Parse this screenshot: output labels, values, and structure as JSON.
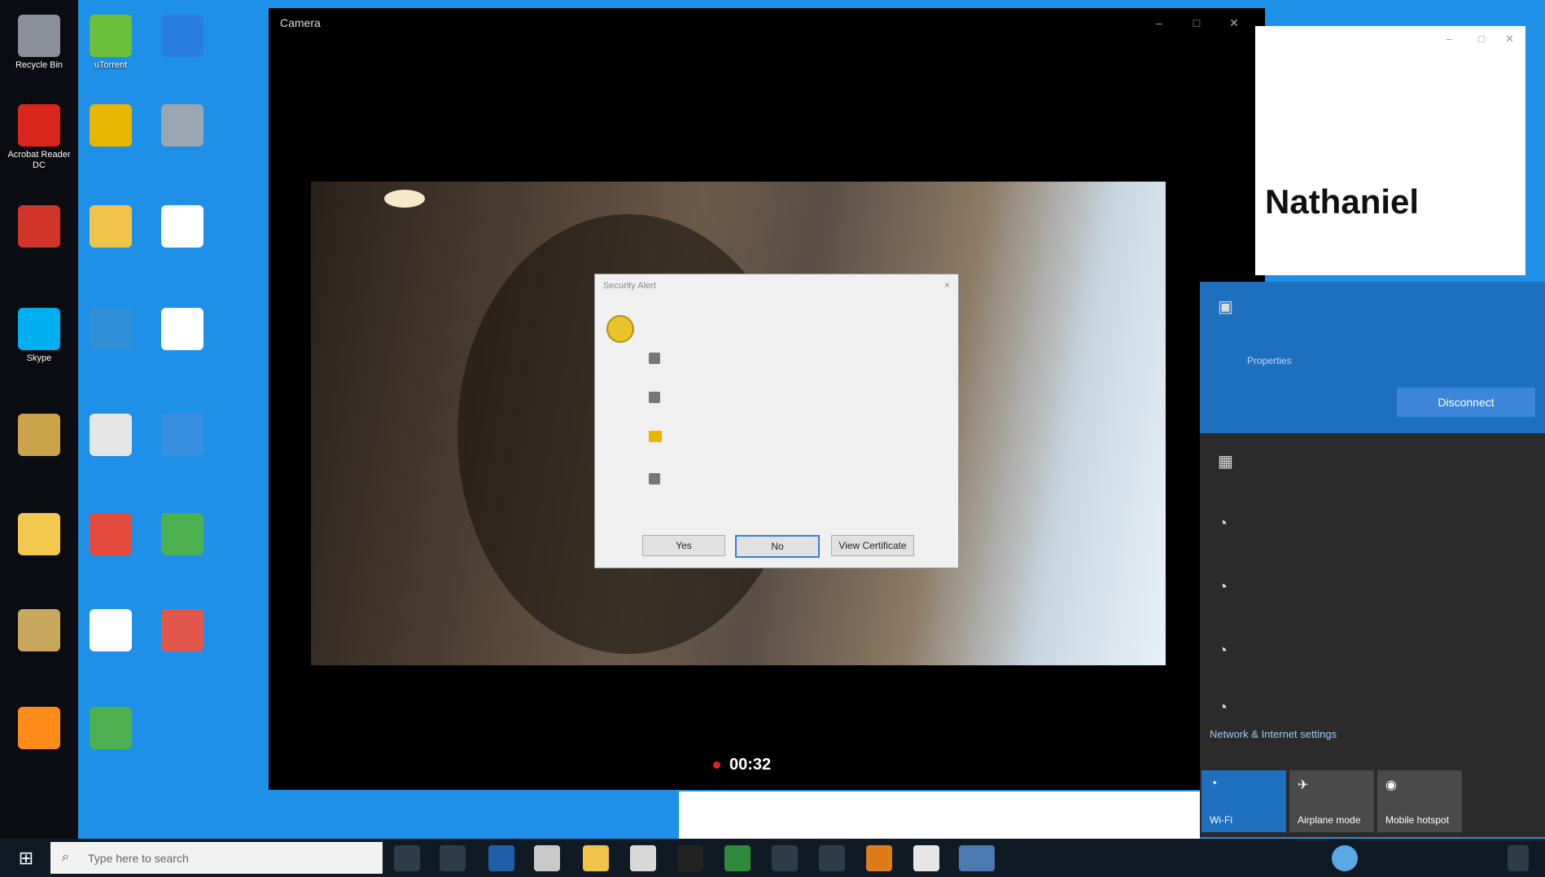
{
  "desktop": {
    "icons": [
      {
        "label": "Recycle Bin",
        "color": "#8a8f98"
      },
      {
        "label": "uTorrent",
        "color": "#6cbf3a"
      },
      {
        "label": "",
        "color": "#2a7ee0"
      },
      {
        "label": "Acrobat Reader DC",
        "color": "#d9261c"
      },
      {
        "label": "",
        "color": "#e8b500"
      },
      {
        "label": "",
        "color": "#9aa6b2"
      },
      {
        "label": "",
        "color": "#d1352a"
      },
      {
        "label": "",
        "color": "#f2c34a"
      },
      {
        "label": "",
        "color": "#ffffff"
      },
      {
        "label": "Skype",
        "color": "#00aff0"
      },
      {
        "label": "",
        "color": "#2f8fd6"
      },
      {
        "label": "",
        "color": "#ffffff"
      },
      {
        "label": "",
        "color": "#caa24a"
      },
      {
        "label": "",
        "color": "#e6e6e6"
      },
      {
        "label": "",
        "color": "#3a8ee0"
      },
      {
        "label": "",
        "color": "#f2c94c"
      },
      {
        "label": "",
        "color": "#e24a3b"
      },
      {
        "label": "",
        "color": "#4caf50"
      },
      {
        "label": "",
        "color": "#c8a85c"
      },
      {
        "label": "",
        "color": "#ffffff"
      },
      {
        "label": "",
        "color": "#ff8c1a"
      },
      {
        "label": "",
        "color": "#4caf50"
      },
      {
        "label": "",
        "color": "#e2574c"
      },
      {
        "label": "",
        "color": "#111111"
      }
    ]
  },
  "camera": {
    "title": "Camera",
    "timer": "00:32"
  },
  "dialog": {
    "title": "Security Alert",
    "close": "×",
    "main_text": "",
    "rows": [
      {
        "text": "",
        "icon": "info"
      },
      {
        "text": "",
        "icon": "info"
      },
      {
        "text": "",
        "icon": "warning"
      },
      {
        "text": "",
        "icon": "info"
      }
    ],
    "question": "",
    "buttons": [
      "Yes",
      "No",
      "View Certificate"
    ]
  },
  "note": {
    "name": "Nathaniel"
  },
  "network": {
    "connected": {
      "name": "",
      "status": "",
      "properties": "Properties",
      "disconnect": "Disconnect"
    },
    "items": [
      {
        "name": "",
        "status": ""
      },
      {
        "name": "",
        "status": ""
      },
      {
        "name": "",
        "status": ""
      },
      {
        "name": "",
        "status": ""
      },
      {
        "name": "",
        "status": ""
      }
    ],
    "settings_title": "Network & Internet settings",
    "settings_sub": "",
    "tiles": [
      {
        "label": "Wi-Fi",
        "icon": "wifi-icon"
      },
      {
        "label": "Airplane mode",
        "icon": "airplane-icon"
      },
      {
        "label": "Mobile hotspot",
        "icon": "hotspot-icon"
      }
    ]
  },
  "taskbar": {
    "search_placeholder": "Type here to search",
    "pinned_preview": "",
    "tray_items": [
      "",
      "",
      ""
    ]
  }
}
